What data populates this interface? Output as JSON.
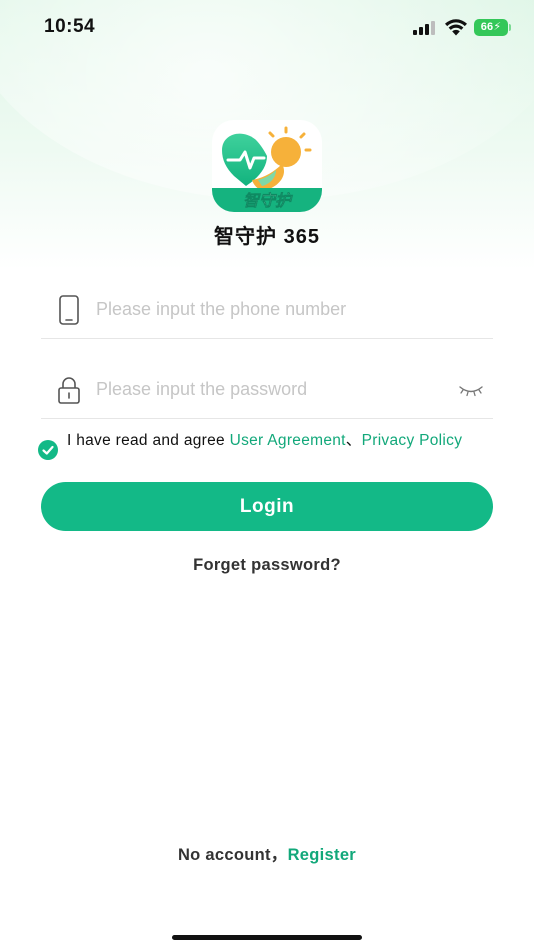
{
  "status_bar": {
    "time": "10:54",
    "battery": "66"
  },
  "app": {
    "logo_text": "智守护",
    "title": "智守护 365"
  },
  "form": {
    "phone_placeholder": "Please input the phone number",
    "phone_value": "",
    "password_placeholder": "Please input the password",
    "password_value": ""
  },
  "agreement": {
    "checked": true,
    "prefix": "I have read and agree ",
    "user_agreement": "User Agreement",
    "separator": "、",
    "privacy_policy": "Privacy Policy"
  },
  "actions": {
    "login_label": "Login",
    "forget_label": "Forget password?",
    "no_account_label": "No account，",
    "register_label": "Register"
  },
  "colors": {
    "accent": "#13b987",
    "link": "#12a87a",
    "logo_heart": "#1fbf88",
    "logo_sun": "#f6b13a"
  },
  "icons": {
    "phone_field": "phone-icon",
    "password_field": "lock-icon",
    "password_toggle": "eye-closed-icon",
    "agreement_check": "check-circle-icon"
  }
}
